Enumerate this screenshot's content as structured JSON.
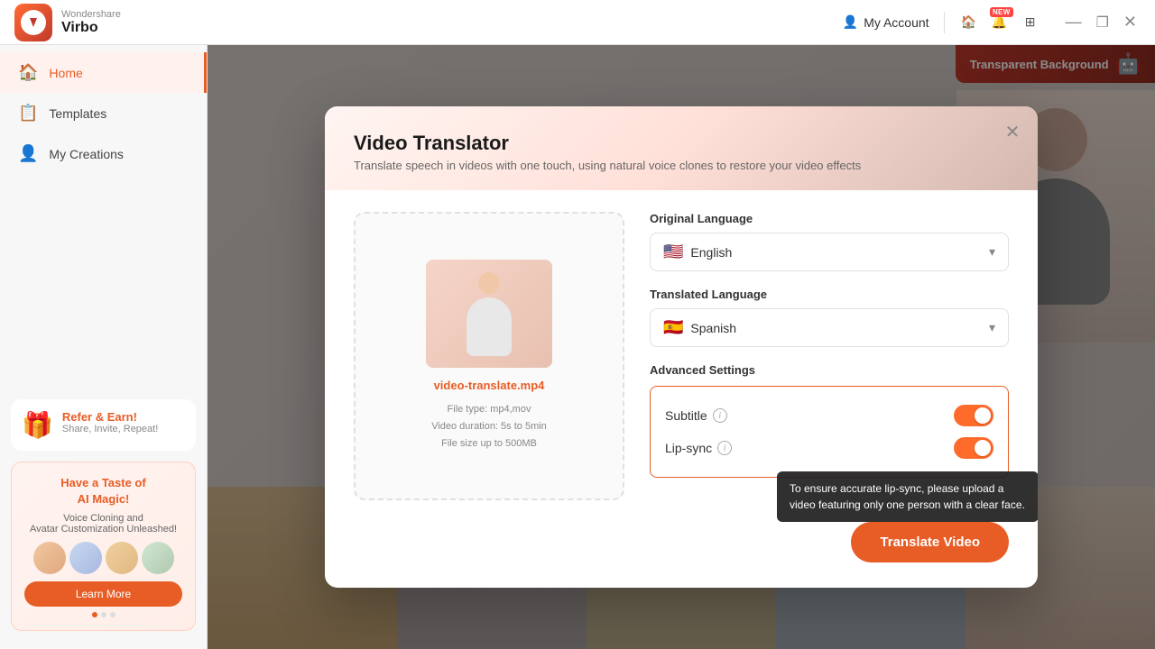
{
  "app": {
    "brand": "Wondershare",
    "name": "Virbo",
    "logo_char": "V"
  },
  "titlebar": {
    "my_account": "My Account",
    "new_badge": "NEW",
    "win_minimize": "—",
    "win_maximize": "❐",
    "win_close": "✕"
  },
  "sidebar": {
    "items": [
      {
        "id": "home",
        "label": "Home",
        "icon": "🏠",
        "active": true
      },
      {
        "id": "templates",
        "label": "Templates",
        "icon": "📋",
        "active": false
      },
      {
        "id": "my-creations",
        "label": "My Creations",
        "icon": "👤",
        "active": false
      }
    ],
    "refer": {
      "title": "Refer & Earn!",
      "subtitle": "Share, Invite, Repeat!"
    },
    "ai_magic": {
      "line1": "Have a Taste of",
      "line2": "AI Magic!",
      "description": "Voice Cloning and\nAvatar Customization Unleashed!",
      "learn_more": "Learn More"
    }
  },
  "background": {
    "transparent_bg": "Transparent Background"
  },
  "modal": {
    "title": "Video Translator",
    "subtitle": "Translate speech in videos with one touch, using natural voice clones to restore your video effects",
    "close_label": "✕",
    "upload": {
      "filename": "video-translate.mp4",
      "file_type": "File type: mp4,mov",
      "duration": "Video duration: 5s to 5min",
      "size": "File size up to  500MB"
    },
    "original_language": {
      "label": "Original Language",
      "selected": "English",
      "flag": "🇺🇸"
    },
    "translated_language": {
      "label": "Translated Language",
      "selected": "Spanish",
      "flag": "🇪🇸"
    },
    "advanced_settings": {
      "title": "Advanced Settings",
      "subtitle": {
        "label": "Subtitle",
        "enabled": true
      },
      "lipsync": {
        "label": "Lip-sync",
        "enabled": true
      },
      "tooltip": "To ensure accurate lip-sync, please upload a video featuring only one person with a clear face."
    },
    "translate_btn": "Translate Video"
  }
}
